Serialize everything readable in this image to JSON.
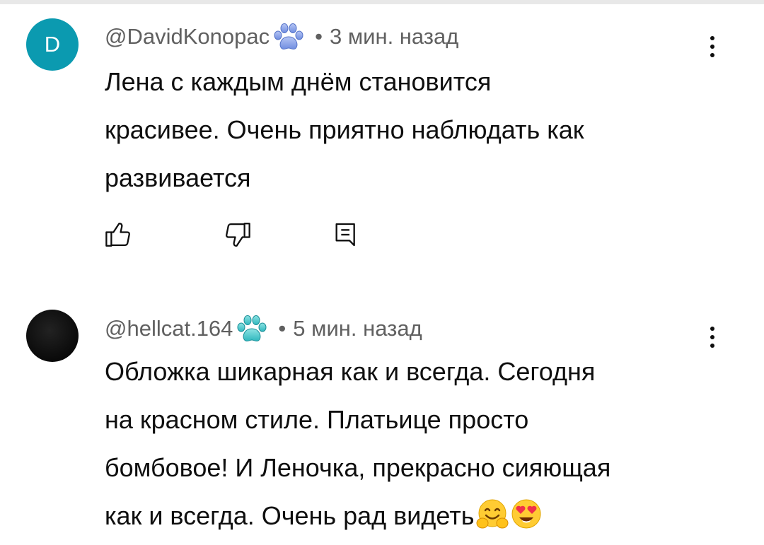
{
  "comments": [
    {
      "avatar_letter": "D",
      "avatar_color": "#0b9ab0",
      "author": "@DavidKonopac",
      "badge_icon": "paw-print-icon",
      "badge_color": "#7d98e6",
      "separator": "•",
      "time": "3 мин. назад",
      "lines": [
        "Лена с каждым днём становится",
        "красивее. Очень приятно наблюдать как",
        "развивается"
      ],
      "actions": [
        "like-icon",
        "dislike-icon",
        "reply-icon"
      ],
      "menu_icon": "more-vert-icon"
    },
    {
      "avatar_letter": "",
      "avatar_color": "#0a0a0a",
      "author": "@hellcat.164",
      "badge_icon": "paw-print-icon",
      "badge_color": "#3fc2c8",
      "separator": "•",
      "time": "5 мин. назад",
      "lines": [
        "Обложка шикарная как и всегда. Сегодня",
        "на красном стиле. Платьице просто",
        "бомбовое! И Леночка, прекрасно сияющая",
        "как и всегда. Очень рад видеть"
      ],
      "emojis": [
        "hugging-face-emoji",
        "heart-eyes-emoji"
      ],
      "menu_icon": "more-vert-icon"
    }
  ]
}
